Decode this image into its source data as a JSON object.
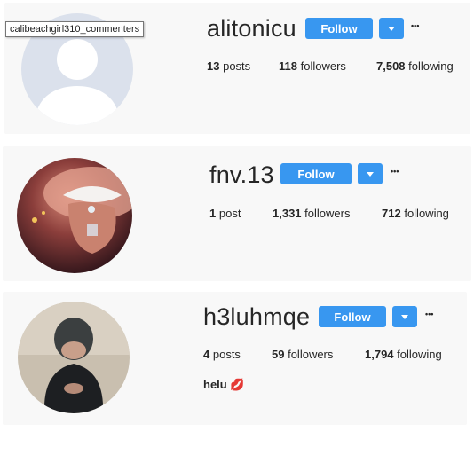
{
  "tooltip": "calibeachgirl310_commenters",
  "profiles": [
    {
      "username": "alitonicu",
      "follow_label": "Follow",
      "more_label": "•••",
      "posts_count": "13",
      "posts_label": "posts",
      "followers_count": "118",
      "followers_label": "followers",
      "following_count": "7,508",
      "following_label": "following",
      "bio": ""
    },
    {
      "username": "fnv.13",
      "follow_label": "Follow",
      "more_label": "•••",
      "posts_count": "1",
      "posts_label": "post",
      "followers_count": "1,331",
      "followers_label": "followers",
      "following_count": "712",
      "following_label": "following",
      "bio": ""
    },
    {
      "username": "h3luhmqe",
      "follow_label": "Follow",
      "more_label": "•••",
      "posts_count": "4",
      "posts_label": "posts",
      "followers_count": "59",
      "followers_label": "followers",
      "following_count": "1,794",
      "following_label": "following",
      "bio": "helu",
      "bio_emoji": "💋"
    }
  ],
  "colors": {
    "accent": "#3897f0",
    "card_bg": "#f8f8f8"
  }
}
